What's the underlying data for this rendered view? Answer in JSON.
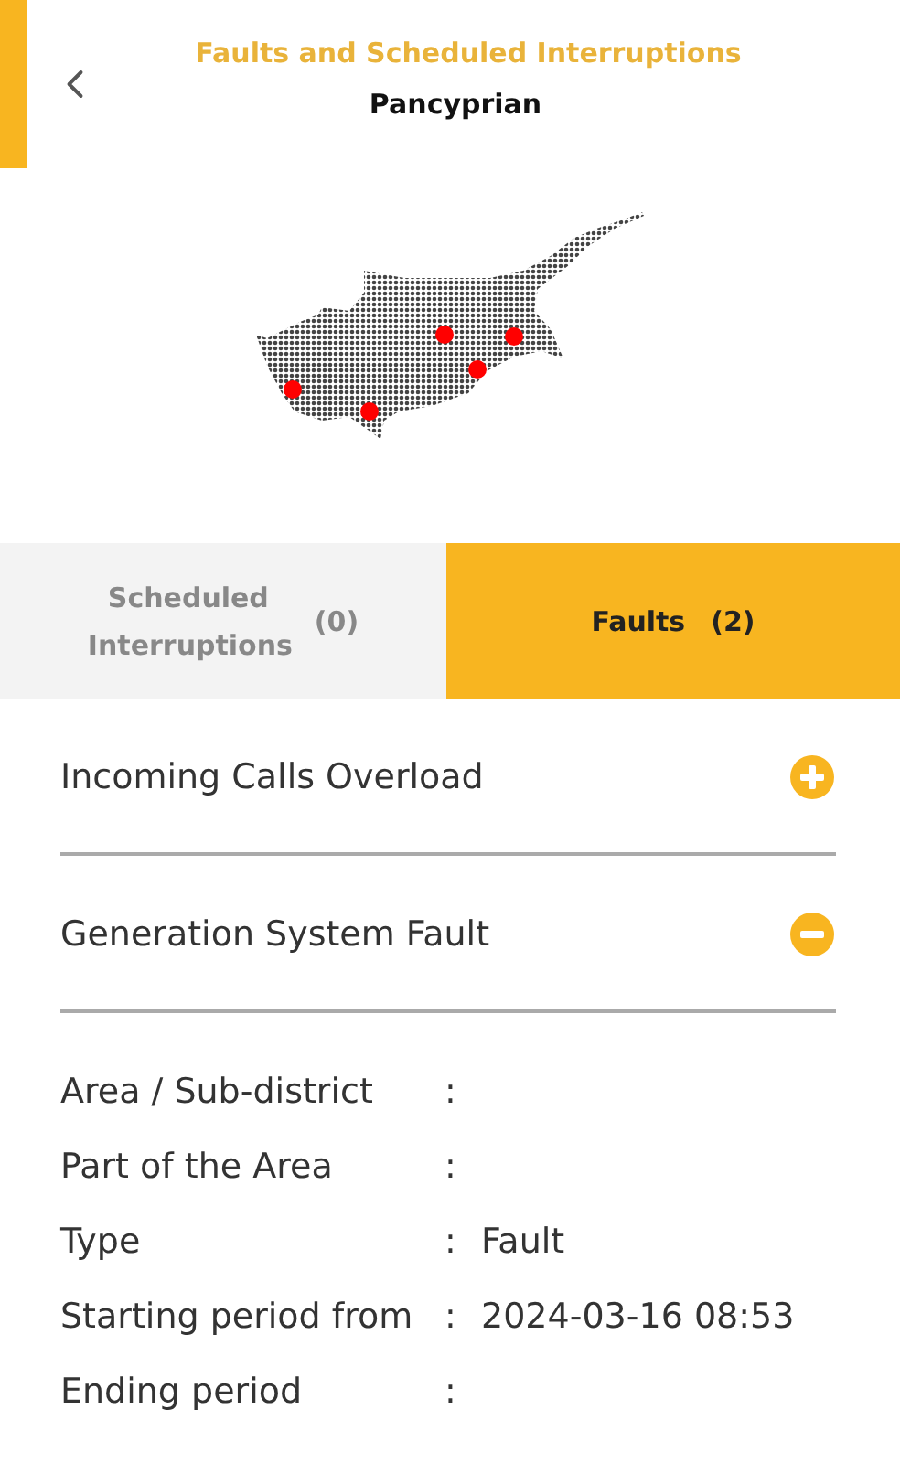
{
  "header": {
    "title": "Faults and Scheduled Interruptions",
    "subtitle": "Pancyprian"
  },
  "tabs": [
    {
      "label": "Scheduled Interruptions",
      "count": "(0)",
      "selected": false
    },
    {
      "label": "Faults",
      "count": "(2)",
      "selected": true
    }
  ],
  "faults": [
    {
      "title": "Incoming Calls Overload",
      "expanded": false
    },
    {
      "title": "Generation System Fault",
      "expanded": true,
      "details": [
        {
          "label": "Area / Sub-district",
          "separator": ":"
        },
        {
          "label": "Part of the Area",
          "separator": ":"
        },
        {
          "label": "Type",
          "separator": ":",
          "value": "Fault"
        },
        {
          "label": "Starting period from",
          "separator": ":",
          "value": "2024-03-16 08:53"
        },
        {
          "label": "Ending period",
          "separator": ":"
        }
      ]
    }
  ]
}
